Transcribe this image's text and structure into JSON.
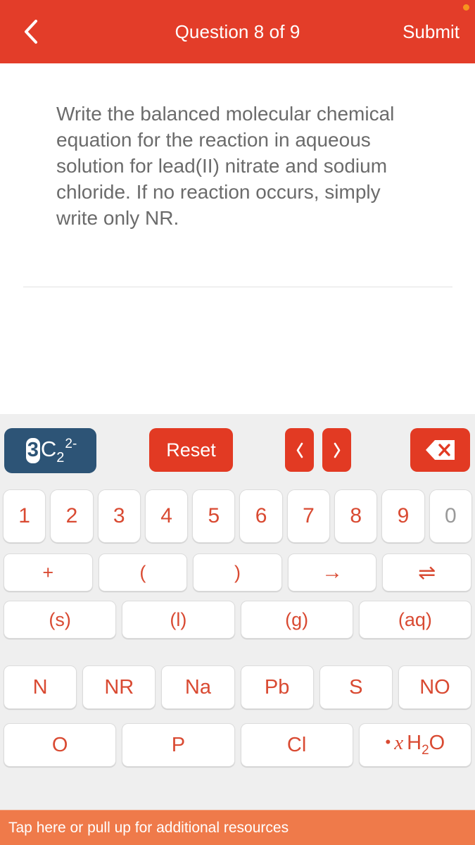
{
  "header": {
    "back_icon": "chevron-left-icon",
    "title": "Question 8 of 9",
    "submit_label": "Submit",
    "accent_color": "#e33d29",
    "status_dot_color": "#f7941e"
  },
  "question": {
    "text": "Write the balanced molecular chemical equation for the reaction in aqueous solution for lead(II) nitrate and sodium chloride. If no reaction occurs, simply write only NR.",
    "answer_value": ""
  },
  "keyboard": {
    "background_color": "#efefef",
    "key_text_color": "#d94a32",
    "badge": {
      "background_color": "#2d5476",
      "coefficient": "3",
      "element": "C",
      "subscript": "2",
      "superscript": "2-"
    },
    "reset_label": "Reset",
    "prev_icon": "chevron-left-icon",
    "next_icon": "chevron-right-icon",
    "delete_icon": "backspace-delete-icon",
    "digits": [
      {
        "label": "1",
        "disabled": false
      },
      {
        "label": "2",
        "disabled": false
      },
      {
        "label": "3",
        "disabled": false
      },
      {
        "label": "4",
        "disabled": false
      },
      {
        "label": "5",
        "disabled": false
      },
      {
        "label": "6",
        "disabled": false
      },
      {
        "label": "7",
        "disabled": false
      },
      {
        "label": "8",
        "disabled": false
      },
      {
        "label": "9",
        "disabled": false
      },
      {
        "label": "0",
        "disabled": true
      }
    ],
    "operators": [
      "+",
      "(",
      ")",
      "→",
      "⇌"
    ],
    "states": [
      "(s)",
      "(l)",
      "(g)",
      "(aq)"
    ],
    "elements_row1": [
      "N",
      "NR",
      "Na",
      "Pb",
      "S",
      "NO"
    ],
    "elements_row2": [
      "O",
      "P",
      "Cl"
    ],
    "hydrate_key": {
      "dot": "•",
      "variable": "x",
      "formula_head": "H",
      "formula_sub": "2",
      "formula_tail": "O"
    }
  },
  "bottom_bar": {
    "text": "Tap here or pull up for additional resources",
    "background_color": "#ef7a4a"
  }
}
